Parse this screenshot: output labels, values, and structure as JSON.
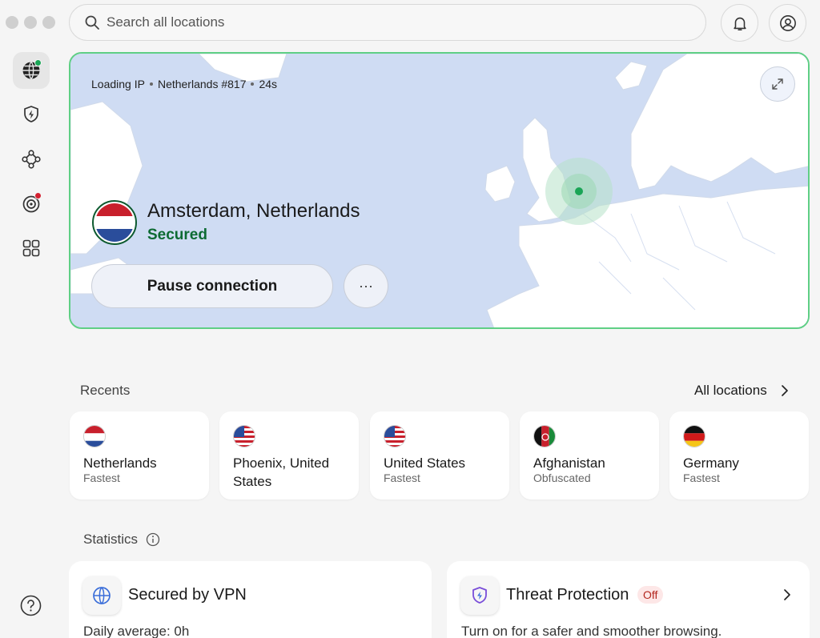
{
  "search": {
    "placeholder": "Search all locations"
  },
  "connection": {
    "status_ip": "Loading IP",
    "server": "Netherlands #817",
    "duration": "24s",
    "city": "Amsterdam, Netherlands",
    "state": "Secured",
    "pause_label": "Pause connection",
    "more_label": "···"
  },
  "recents": {
    "title": "Recents",
    "all_label": "All locations",
    "items": [
      {
        "name": "Netherlands",
        "sub": "Fastest",
        "flag": "netherlands"
      },
      {
        "name": "Phoenix, United States",
        "sub": "",
        "flag": "united-states"
      },
      {
        "name": "United States",
        "sub": "Fastest",
        "flag": "united-states"
      },
      {
        "name": "Afghanistan",
        "sub": "Obfuscated",
        "flag": "afghanistan"
      },
      {
        "name": "Germany",
        "sub": "Fastest",
        "flag": "germany"
      }
    ]
  },
  "statistics": {
    "title": "Statistics",
    "vpn": {
      "name": "Secured by VPN",
      "sub": "Daily average: 0h"
    },
    "threat": {
      "name": "Threat Protection",
      "badge": "Off",
      "sub": "Turn on for a safer and smoother browsing."
    }
  },
  "colors": {
    "accent_green": "#0d6b33",
    "card_border": "#5fcf85",
    "map_water": "#cfdcf3",
    "map_land": "#ffffff",
    "badge_red": "#b3261e"
  },
  "icons": [
    "search-icon",
    "bell-icon",
    "account-icon",
    "globe-icon",
    "shield-bolt-icon",
    "mesh-icon",
    "target-icon",
    "apps-icon",
    "help-icon",
    "expand-icon",
    "info-icon",
    "chevron-right-icon"
  ]
}
